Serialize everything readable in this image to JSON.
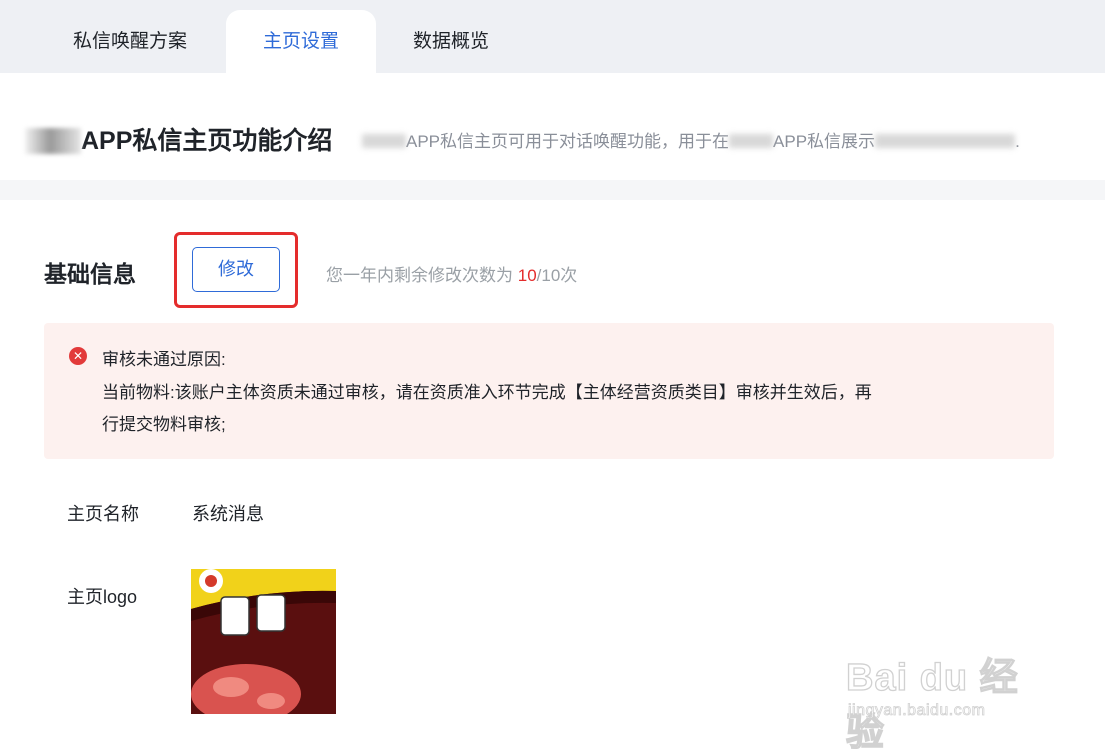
{
  "tabs": [
    {
      "label": "私信唤醒方案",
      "active": false
    },
    {
      "label": "主页设置",
      "active": true
    },
    {
      "label": "数据概览",
      "active": false
    }
  ],
  "intro": {
    "title": "APP私信主页功能介绍",
    "desc_a": "APP私信主页可用于对话唤醒功能，用于在",
    "desc_b": "APP私信展示",
    "desc_end": "."
  },
  "basic_info": {
    "title": "基础信息",
    "edit_label": "修改",
    "remain_prefix": "您一年内剩余修改次数为 ",
    "remain_count": "10",
    "remain_suffix": "/10次"
  },
  "alert": {
    "icon": "close-circle-icon",
    "title": "审核未通过原因:",
    "line1": "当前物料:该账户主体资质未通过审核，请在资质准入环节完成【主体经营资质类目】审核并生效后，再",
    "line2": "行提交物料审核;"
  },
  "fields": {
    "name_label": "主页名称",
    "name_value": "系统消息",
    "logo_label": "主页logo"
  },
  "watermark": {
    "main": "Bai du 经验",
    "sub": "jingyan.baidu.com"
  },
  "colors": {
    "accent": "#2f6bd8",
    "danger": "#e42c2c",
    "alert_bg": "#fdf1ef",
    "tabbar_bg": "#eef0f4"
  }
}
